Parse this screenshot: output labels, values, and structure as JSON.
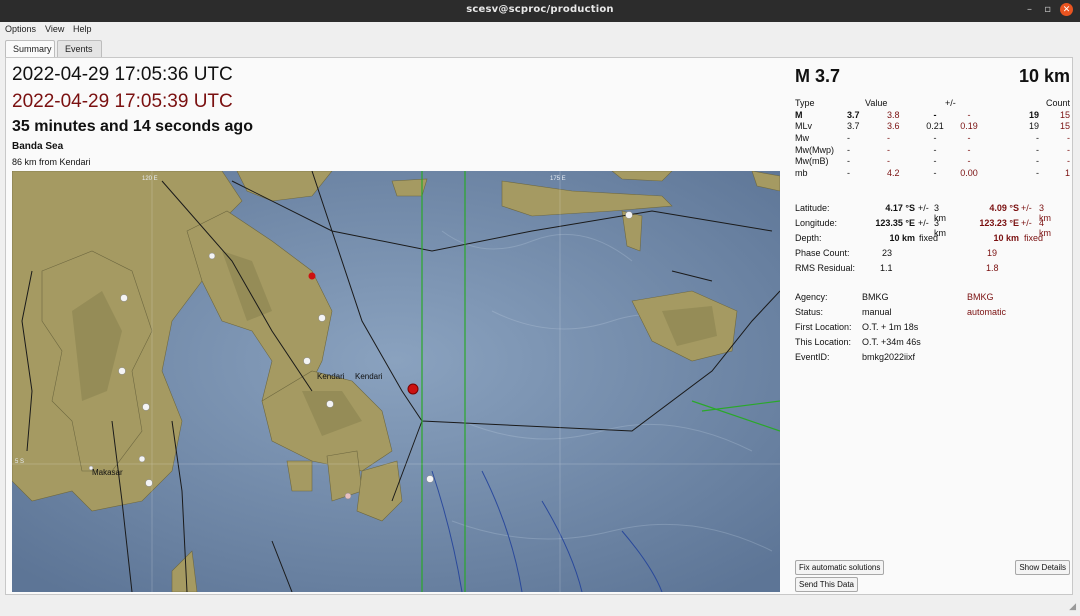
{
  "window": {
    "title": "scesv@scproc/production",
    "min": "–",
    "max": "▫",
    "close": "✕"
  },
  "menu": [
    "Options",
    "View",
    "Help"
  ],
  "tabs": [
    "Summary",
    "Events"
  ],
  "summary": {
    "time_primary": "2022-04-29 17:05:36 UTC",
    "time_secondary": "2022-04-29 17:05:39 UTC",
    "elapsed": "35 minutes and 14 seconds ago",
    "region": "Banda Sea",
    "distance": "86 km from Kendari",
    "magnitude": "M 3.7",
    "depth": "10 km"
  },
  "map": {
    "lat_labels": [
      "5 S"
    ],
    "lon_labels": [
      "175 E",
      "120 E"
    ],
    "places": [
      "Kendari",
      "Kendari",
      "Makasar"
    ]
  },
  "magnitudes": {
    "headers": {
      "type": "Type",
      "value": "Value",
      "pm": "+/-",
      "count": "Count"
    },
    "rows": [
      {
        "type": "M",
        "v1": "3.7",
        "v2": "3.8",
        "e1": "-",
        "e2": "-",
        "c1": "19",
        "c2": "15"
      },
      {
        "type": "MLv",
        "v1": "3.7",
        "v2": "3.6",
        "e1": "0.21",
        "e2": "0.19",
        "c1": "19",
        "c2": "15"
      },
      {
        "type": "Mw",
        "v1": "-",
        "v2": "-",
        "e1": "-",
        "e2": "-",
        "c1": "-",
        "c2": "-"
      },
      {
        "type": "Mw(Mwp)",
        "v1": "-",
        "v2": "-",
        "e1": "-",
        "e2": "-",
        "c1": "-",
        "c2": "-"
      },
      {
        "type": "Mw(mB)",
        "v1": "-",
        "v2": "-",
        "e1": "-",
        "e2": "-",
        "c1": "-",
        "c2": "-"
      },
      {
        "type": "mb",
        "v1": "-",
        "v2": "4.2",
        "e1": "-",
        "e2": "0.00",
        "c1": "-",
        "c2": "1"
      }
    ]
  },
  "origin": {
    "latitude_label": "Latitude:",
    "lat1": "4.17 °S",
    "lat1_pm": "+/-",
    "lat1_err": "3 km",
    "lat2": "4.09 °S",
    "lat2_pm": "+/-",
    "lat2_err": "3 km",
    "longitude_label": "Longitude:",
    "lon1": "123.35 °E",
    "lon1_pm": "+/-",
    "lon1_err": "3 km",
    "lon2": "123.23 °E",
    "lon2_pm": "+/-",
    "lon2_err": "4 km",
    "depth_label": "Depth:",
    "dep1": "10 km",
    "dep1_flag": "fixed",
    "dep2": "10 km",
    "dep2_flag": "fixed",
    "phase_label": "Phase Count:",
    "phase1": "23",
    "phase2": "19",
    "rms_label": "RMS Residual:",
    "rms1": "1.1",
    "rms2": "1.8"
  },
  "meta": {
    "agency_label": "Agency:",
    "agency1": "BMKG",
    "agency2": "BMKG",
    "status_label": "Status:",
    "status1": "manual",
    "status2": "automatic",
    "first_label": "First Location:",
    "first": "O.T. + 1m 18s",
    "this_label": "This Location:",
    "this": "O.T. +34m 46s",
    "eventid_label": "EventID:",
    "eventid": "bmkg2022iixf"
  },
  "buttons": {
    "fix": "Fix automatic solutions",
    "send": "Send This Data",
    "details": "Show Details"
  },
  "colors": {
    "titlebar": "#2c2c2c",
    "accent_red": "#7a1010",
    "close": "#e95420",
    "epicenter": "#cc1111",
    "ocean": "#6f86a6",
    "land": "#a59a62"
  }
}
